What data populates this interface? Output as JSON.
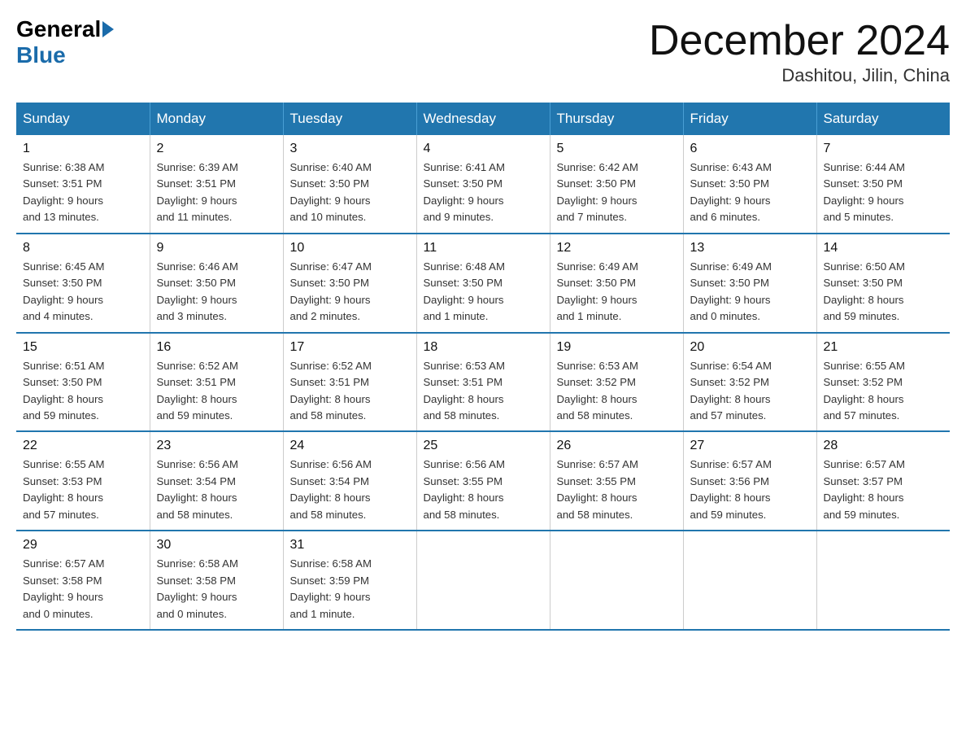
{
  "header": {
    "logo_general": "General",
    "logo_blue": "Blue",
    "month_title": "December 2024",
    "location": "Dashitou, Jilin, China"
  },
  "days_of_week": [
    "Sunday",
    "Monday",
    "Tuesday",
    "Wednesday",
    "Thursday",
    "Friday",
    "Saturday"
  ],
  "weeks": [
    [
      {
        "day": "1",
        "info": "Sunrise: 6:38 AM\nSunset: 3:51 PM\nDaylight: 9 hours\nand 13 minutes."
      },
      {
        "day": "2",
        "info": "Sunrise: 6:39 AM\nSunset: 3:51 PM\nDaylight: 9 hours\nand 11 minutes."
      },
      {
        "day": "3",
        "info": "Sunrise: 6:40 AM\nSunset: 3:50 PM\nDaylight: 9 hours\nand 10 minutes."
      },
      {
        "day": "4",
        "info": "Sunrise: 6:41 AM\nSunset: 3:50 PM\nDaylight: 9 hours\nand 9 minutes."
      },
      {
        "day": "5",
        "info": "Sunrise: 6:42 AM\nSunset: 3:50 PM\nDaylight: 9 hours\nand 7 minutes."
      },
      {
        "day": "6",
        "info": "Sunrise: 6:43 AM\nSunset: 3:50 PM\nDaylight: 9 hours\nand 6 minutes."
      },
      {
        "day": "7",
        "info": "Sunrise: 6:44 AM\nSunset: 3:50 PM\nDaylight: 9 hours\nand 5 minutes."
      }
    ],
    [
      {
        "day": "8",
        "info": "Sunrise: 6:45 AM\nSunset: 3:50 PM\nDaylight: 9 hours\nand 4 minutes."
      },
      {
        "day": "9",
        "info": "Sunrise: 6:46 AM\nSunset: 3:50 PM\nDaylight: 9 hours\nand 3 minutes."
      },
      {
        "day": "10",
        "info": "Sunrise: 6:47 AM\nSunset: 3:50 PM\nDaylight: 9 hours\nand 2 minutes."
      },
      {
        "day": "11",
        "info": "Sunrise: 6:48 AM\nSunset: 3:50 PM\nDaylight: 9 hours\nand 1 minute."
      },
      {
        "day": "12",
        "info": "Sunrise: 6:49 AM\nSunset: 3:50 PM\nDaylight: 9 hours\nand 1 minute."
      },
      {
        "day": "13",
        "info": "Sunrise: 6:49 AM\nSunset: 3:50 PM\nDaylight: 9 hours\nand 0 minutes."
      },
      {
        "day": "14",
        "info": "Sunrise: 6:50 AM\nSunset: 3:50 PM\nDaylight: 8 hours\nand 59 minutes."
      }
    ],
    [
      {
        "day": "15",
        "info": "Sunrise: 6:51 AM\nSunset: 3:50 PM\nDaylight: 8 hours\nand 59 minutes."
      },
      {
        "day": "16",
        "info": "Sunrise: 6:52 AM\nSunset: 3:51 PM\nDaylight: 8 hours\nand 59 minutes."
      },
      {
        "day": "17",
        "info": "Sunrise: 6:52 AM\nSunset: 3:51 PM\nDaylight: 8 hours\nand 58 minutes."
      },
      {
        "day": "18",
        "info": "Sunrise: 6:53 AM\nSunset: 3:51 PM\nDaylight: 8 hours\nand 58 minutes."
      },
      {
        "day": "19",
        "info": "Sunrise: 6:53 AM\nSunset: 3:52 PM\nDaylight: 8 hours\nand 58 minutes."
      },
      {
        "day": "20",
        "info": "Sunrise: 6:54 AM\nSunset: 3:52 PM\nDaylight: 8 hours\nand 57 minutes."
      },
      {
        "day": "21",
        "info": "Sunrise: 6:55 AM\nSunset: 3:52 PM\nDaylight: 8 hours\nand 57 minutes."
      }
    ],
    [
      {
        "day": "22",
        "info": "Sunrise: 6:55 AM\nSunset: 3:53 PM\nDaylight: 8 hours\nand 57 minutes."
      },
      {
        "day": "23",
        "info": "Sunrise: 6:56 AM\nSunset: 3:54 PM\nDaylight: 8 hours\nand 58 minutes."
      },
      {
        "day": "24",
        "info": "Sunrise: 6:56 AM\nSunset: 3:54 PM\nDaylight: 8 hours\nand 58 minutes."
      },
      {
        "day": "25",
        "info": "Sunrise: 6:56 AM\nSunset: 3:55 PM\nDaylight: 8 hours\nand 58 minutes."
      },
      {
        "day": "26",
        "info": "Sunrise: 6:57 AM\nSunset: 3:55 PM\nDaylight: 8 hours\nand 58 minutes."
      },
      {
        "day": "27",
        "info": "Sunrise: 6:57 AM\nSunset: 3:56 PM\nDaylight: 8 hours\nand 59 minutes."
      },
      {
        "day": "28",
        "info": "Sunrise: 6:57 AM\nSunset: 3:57 PM\nDaylight: 8 hours\nand 59 minutes."
      }
    ],
    [
      {
        "day": "29",
        "info": "Sunrise: 6:57 AM\nSunset: 3:58 PM\nDaylight: 9 hours\nand 0 minutes."
      },
      {
        "day": "30",
        "info": "Sunrise: 6:58 AM\nSunset: 3:58 PM\nDaylight: 9 hours\nand 0 minutes."
      },
      {
        "day": "31",
        "info": "Sunrise: 6:58 AM\nSunset: 3:59 PM\nDaylight: 9 hours\nand 1 minute."
      },
      {
        "day": "",
        "info": ""
      },
      {
        "day": "",
        "info": ""
      },
      {
        "day": "",
        "info": ""
      },
      {
        "day": "",
        "info": ""
      }
    ]
  ]
}
